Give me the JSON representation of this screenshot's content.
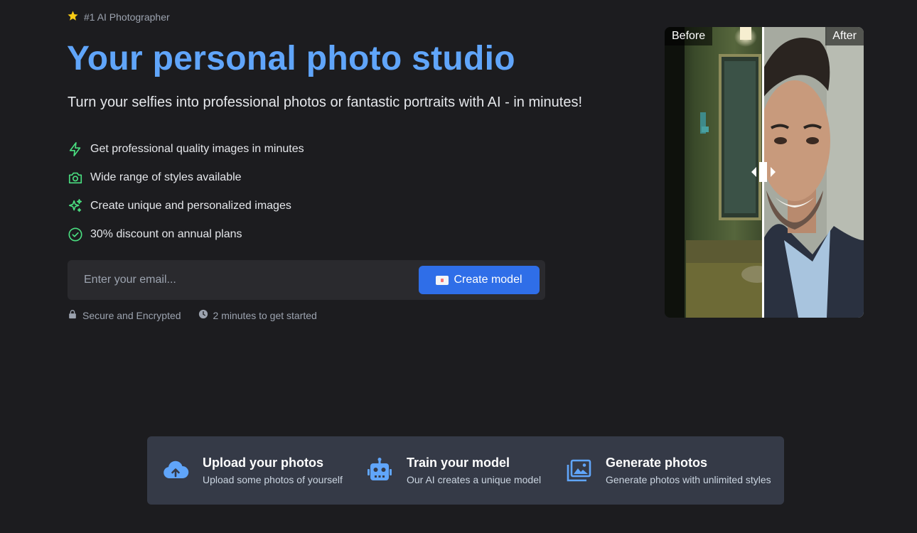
{
  "badge": {
    "icon": "star-icon",
    "text": "#1 AI Photographer"
  },
  "hero": {
    "title": "Your personal photo studio",
    "subtitle": "Turn your selfies into professional photos or fantastic portraits with AI - in minutes!"
  },
  "features": [
    {
      "icon": "lightning-icon",
      "text": "Get professional quality images in minutes"
    },
    {
      "icon": "camera-icon",
      "text": "Wide range of styles available"
    },
    {
      "icon": "sparkles-icon",
      "text": "Create unique and personalized images"
    },
    {
      "icon": "check-circle-icon",
      "text": "30% discount on annual plans"
    }
  ],
  "signup": {
    "email_placeholder": "Enter your email...",
    "button_label": "Create model"
  },
  "trust": {
    "secure": "Secure and Encrypted",
    "time": "2 minutes to get started"
  },
  "compare": {
    "before_label": "Before",
    "after_label": "After"
  },
  "steps": [
    {
      "icon": "cloud-upload-icon",
      "title": "Upload your photos",
      "desc": "Upload some photos of yourself"
    },
    {
      "icon": "robot-icon",
      "title": "Train your model",
      "desc": "Our AI creates a unique model"
    },
    {
      "icon": "images-icon",
      "title": "Generate photos",
      "desc": "Generate photos with unlimited styles"
    }
  ],
  "colors": {
    "background": "#1c1c1f",
    "accent": "#60a5fa",
    "button": "#2f6ee8",
    "feature_icon": "#4ade80",
    "steps_bar": "#353a47"
  }
}
